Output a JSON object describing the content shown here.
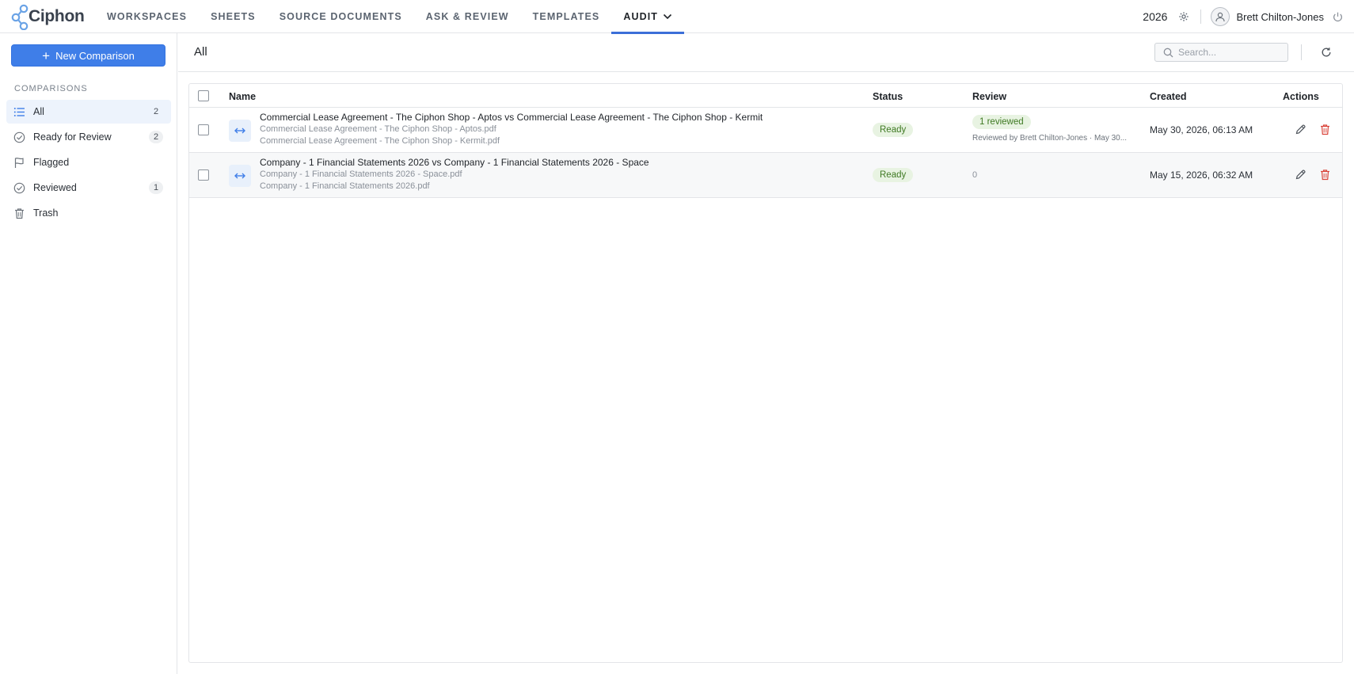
{
  "brand": {
    "name": "Ciphon"
  },
  "nav": {
    "items": [
      {
        "label": "WORKSPACES"
      },
      {
        "label": "SHEETS"
      },
      {
        "label": "SOURCE DOCUMENTS"
      },
      {
        "label": "ASK & REVIEW"
      },
      {
        "label": "TEMPLATES"
      },
      {
        "label": "AUDIT",
        "active": true
      }
    ]
  },
  "header": {
    "year": "2026",
    "user_name": "Brett Chilton-Jones"
  },
  "sidebar": {
    "new_button": "New Comparison",
    "section_label": "COMPARISONS",
    "items": [
      {
        "label": "All",
        "count": "2",
        "icon": "list-icon",
        "active": true
      },
      {
        "label": "Ready for Review",
        "count": "2",
        "icon": "check-circle-icon"
      },
      {
        "label": "Flagged",
        "count": "",
        "icon": "flag-icon"
      },
      {
        "label": "Reviewed",
        "count": "1",
        "icon": "check-circle-icon"
      },
      {
        "label": "Trash",
        "count": "",
        "icon": "trash-icon"
      }
    ]
  },
  "main": {
    "title": "All",
    "search_placeholder": "Search...",
    "columns": {
      "name": "Name",
      "status": "Status",
      "review": "Review",
      "created": "Created",
      "actions": "Actions"
    },
    "rows": [
      {
        "title": "Commercial Lease Agreement - The Ciphon Shop - Aptos vs Commercial Lease Agreement - The Ciphon Shop - Kermit",
        "file_a": "Commercial Lease Agreement - The Ciphon Shop - Aptos.pdf",
        "file_b": "Commercial Lease Agreement - The Ciphon Shop - Kermit.pdf",
        "status": "Ready",
        "review_badge": "1 reviewed",
        "review_by": "Reviewed by Brett Chilton-Jones · May 30...",
        "created": "May 30, 2026, 06:13 AM"
      },
      {
        "title": "Company - 1 Financial Statements 2026 vs Company - 1 Financial Statements 2026 - Space",
        "file_a": "Company - 1 Financial Statements 2026 - Space.pdf",
        "file_b": "Company - 1 Financial Statements 2026.pdf",
        "status": "Ready",
        "review_count": "0",
        "created": "May 15, 2026, 06:32 AM"
      }
    ]
  },
  "colors": {
    "accent": "#3f7ee8",
    "ready_bg": "#e8f3e2",
    "ready_text": "#3f7a23",
    "delete": "#d9443a"
  }
}
